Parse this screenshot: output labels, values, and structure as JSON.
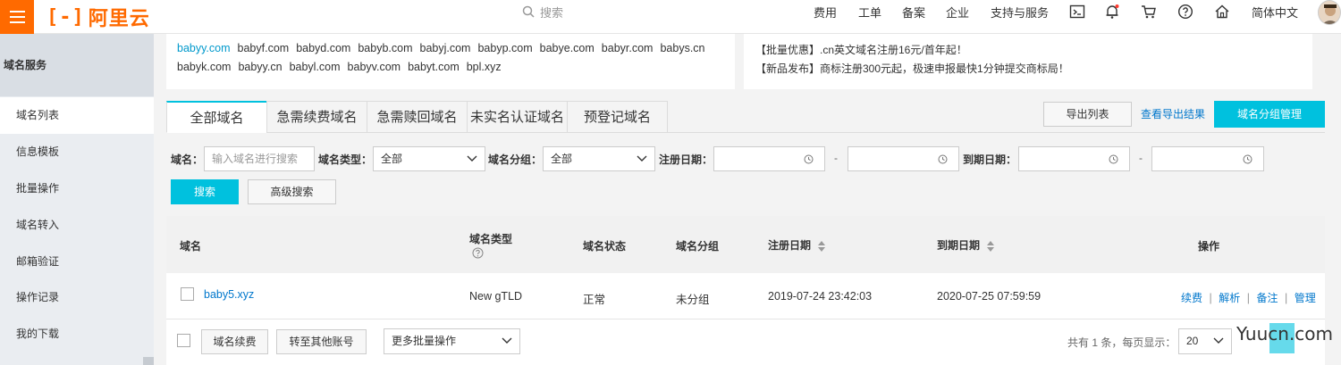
{
  "header": {
    "logo_text": "阿里云",
    "search_placeholder": "搜索",
    "nav": [
      "费用",
      "工单",
      "备案",
      "企业",
      "支持与服务"
    ],
    "language": "简体中文"
  },
  "sidebar": {
    "title": "域名服务",
    "items": [
      {
        "label": "域名列表"
      },
      {
        "label": "信息模板"
      },
      {
        "label": "批量操作"
      },
      {
        "label": "域名转入"
      },
      {
        "label": "邮箱验证"
      },
      {
        "label": "操作记录"
      },
      {
        "label": "我的下载"
      }
    ]
  },
  "suggested_domains": {
    "row1": [
      "babyy.com",
      "babyf.com",
      "babyd.com",
      "babyb.com",
      "babyj.com",
      "babyp.com",
      "babye.com",
      "babyr.com",
      "babys.cn"
    ],
    "row2": [
      "babyk.com",
      "babyy.cn",
      "babyl.com",
      "babyv.com",
      "babyt.com",
      "bpl.xyz"
    ]
  },
  "promos": [
    "【批量优惠】.cn英文域名注册16元/首年起！",
    "【新品发布】商标注册300元起，极速申报最快1分钟提交商标局！"
  ],
  "tabs": [
    "全部域名",
    "急需续费域名",
    "急需赎回域名",
    "未实名认证域名",
    "预登记域名"
  ],
  "toolbar": {
    "export_label": "导出列表",
    "view_export_label": "查看导出结果",
    "group_manage_label": "域名分组管理"
  },
  "filters": {
    "domain_label": "域名：",
    "domain_placeholder": "输入域名进行搜索",
    "type_label": "域名类型：",
    "type_value": "全部",
    "group_label": "域名分组：",
    "group_value": "全部",
    "reg_date_label": "注册日期：",
    "exp_date_label": "到期日期：",
    "dash": "-",
    "search_btn": "搜索",
    "advanced_btn": "高级搜索"
  },
  "table": {
    "headers": {
      "domain": "域名",
      "type": "域名类型",
      "status": "域名状态",
      "group": "域名分组",
      "reg_date": "注册日期",
      "exp_date": "到期日期",
      "actions": "操作"
    },
    "rows": [
      {
        "domain": "baby5.xyz",
        "type": "New gTLD",
        "status": "正常",
        "group": "未分组",
        "reg_date": "2019-07-24 23:42:03",
        "exp_date": "2020-07-25 07:59:59",
        "actions": [
          "续费",
          "解析",
          "备注",
          "管理"
        ]
      }
    ],
    "separator": "|"
  },
  "footer": {
    "renew_btn": "域名续费",
    "transfer_btn": "转至其他账号",
    "batch_select": "更多批量操作",
    "total_text": "共有 1 条，每页显示：",
    "page_size": "20"
  },
  "watermark": "Yuucn.com",
  "colors": {
    "brand": "#ff6a00",
    "primary": "#00c1de",
    "link": "#0077cc"
  }
}
